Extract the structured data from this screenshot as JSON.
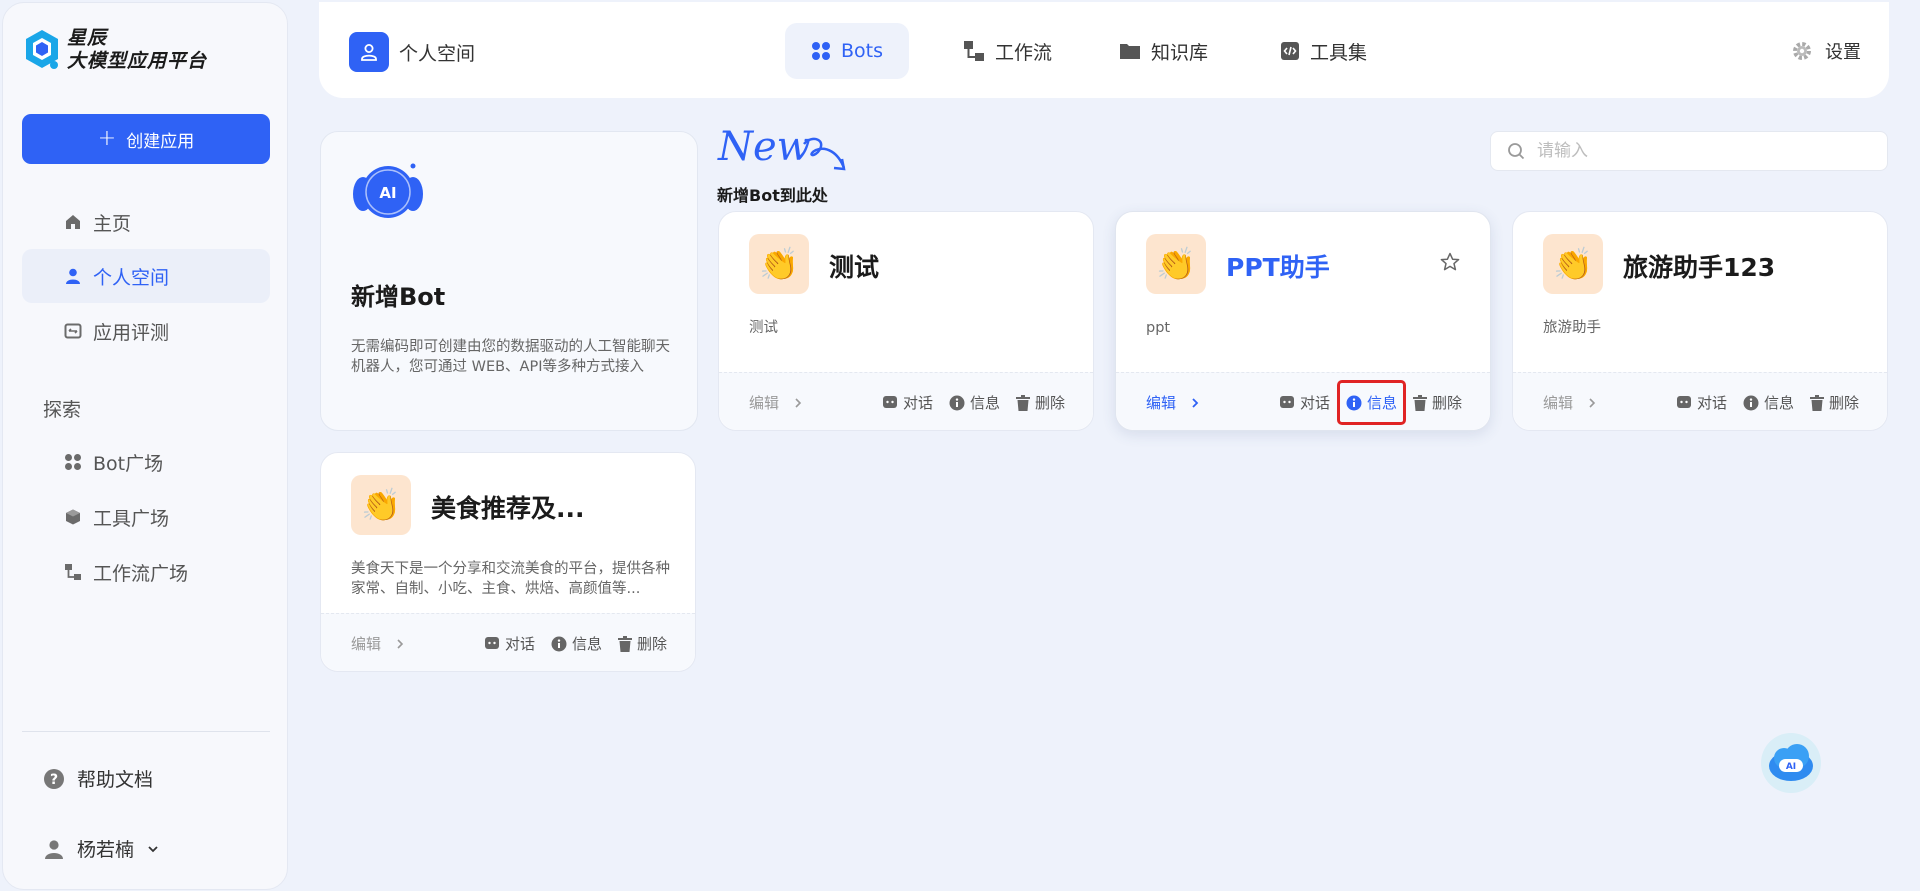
{
  "app": {
    "brand_line1": "星辰",
    "brand_line2": "大模型应用平台",
    "create_label": "创建应用"
  },
  "sidebar": {
    "items": [
      {
        "label": "主页",
        "icon": "home-icon"
      },
      {
        "label": "个人空间",
        "icon": "user-icon",
        "active": true
      },
      {
        "label": "应用评测",
        "icon": "evaluation-icon"
      }
    ],
    "explore_title": "探索",
    "explore_items": [
      {
        "label": "Bot广场",
        "icon": "grid-icon"
      },
      {
        "label": "工具广场",
        "icon": "cube-icon"
      },
      {
        "label": "工作流广场",
        "icon": "workflow-icon"
      }
    ],
    "help_label": "帮助文档",
    "user_name": "杨若楠"
  },
  "header": {
    "space_label": "个人空间",
    "tabs": [
      {
        "label": "Bots",
        "active": true
      },
      {
        "label": "工作流"
      },
      {
        "label": "知识库"
      },
      {
        "label": "工具集"
      }
    ],
    "settings_label": "设置"
  },
  "new_bot": {
    "title": "新增Bot",
    "desc": "无需编码即可创建由您的数据驱动的人工智能聊天机器人，您可通过 WEB、API等多种方式接入",
    "badge_word": "New",
    "badge_text": "新增Bot到此处",
    "ai_label": "AI"
  },
  "search": {
    "placeholder": "请输入"
  },
  "bots": [
    {
      "name": "测试",
      "desc": "测试"
    },
    {
      "name": "PPT助手",
      "desc": "ppt"
    },
    {
      "name": "旅游助手123",
      "desc": "旅游助手"
    },
    {
      "name": "美食推荐及...",
      "desc": "美食天下是一个分享和交流美食的平台，提供各种家常、自制、小吃、主食、烘焙、高颜值等..."
    }
  ],
  "card_actions": {
    "edit": "编辑",
    "chat": "对话",
    "info": "信息",
    "delete": "删除"
  },
  "colors": {
    "accent": "#2f62f5",
    "highlight": "#e02424",
    "avatar_bg": "#fde5cf"
  }
}
